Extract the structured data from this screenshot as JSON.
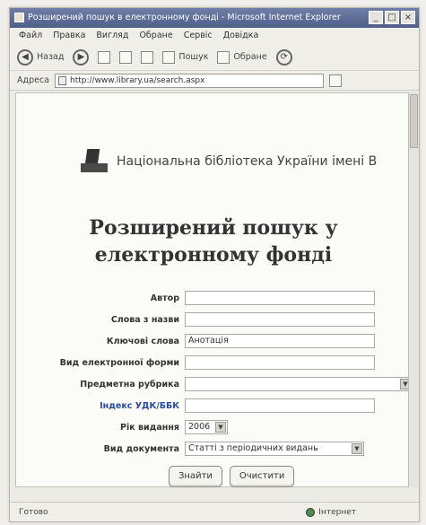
{
  "window": {
    "title": "Розширений пошук в електронному фонді - Microsoft Internet Explorer",
    "buttons": [
      "_",
      "□",
      "×"
    ]
  },
  "menu": [
    "Файл",
    "Правка",
    "Вигляд",
    "Обране",
    "Сервіс",
    "Довідка"
  ],
  "toolbar": {
    "back_label": "Назад",
    "search_label": "Пошук",
    "favorites_label": "Обране"
  },
  "address": {
    "label": "Адреса",
    "url": "http://www.library.ua/search.aspx"
  },
  "page": {
    "logo_text": "Національна бібліотека України імені В",
    "heading_line1": "Розширений пошук у",
    "heading_line2": "електронному фонді"
  },
  "form": {
    "fields": [
      {
        "label": "Автор",
        "value": ""
      },
      {
        "label": "Слова з назви",
        "value": ""
      },
      {
        "label": "Ключові слова",
        "value": "Анотація"
      },
      {
        "label": "Вид електронної форми",
        "value": ""
      },
      {
        "label": "Предметна рубрика",
        "value": ""
      },
      {
        "label": "Індекс УДК/ББК",
        "value": ""
      },
      {
        "label": "Рік видання",
        "value": "2006"
      },
      {
        "label": "Вид документа",
        "value": "Статті з періодичних видань"
      }
    ],
    "search_button": "Знайти",
    "clear_button": "Очистити"
  },
  "status": {
    "left": "Готово",
    "right": "Інтернет"
  }
}
